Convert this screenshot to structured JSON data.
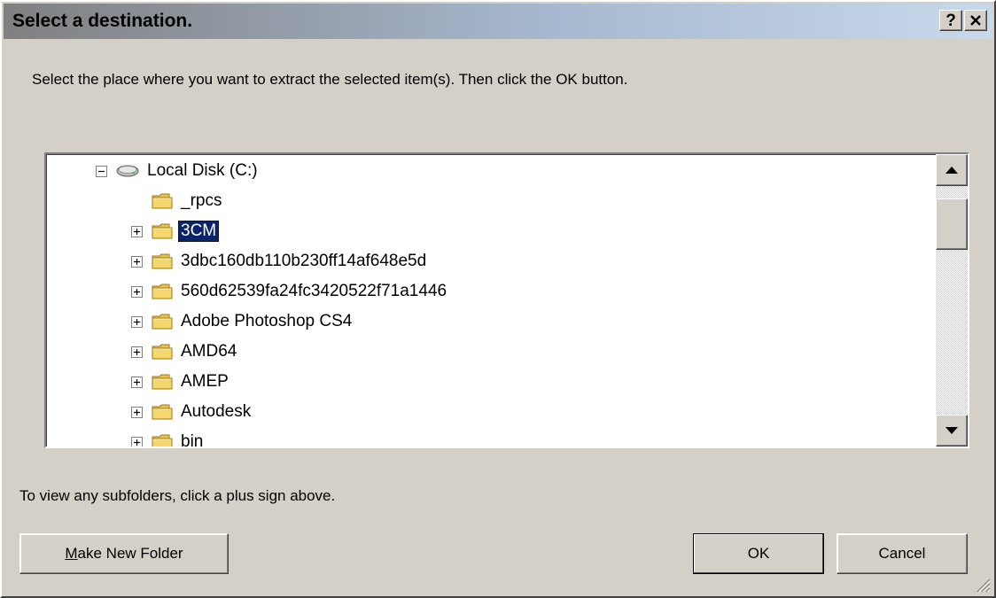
{
  "window": {
    "title": "Select a destination.",
    "help_label": "?"
  },
  "instructions": "Select the place where you want to extract the selected item(s).  Then click the OK button.",
  "tree": {
    "root": {
      "label": "Local Disk (C:)",
      "expanded": true,
      "icon": "hard-disk-icon"
    },
    "items": [
      {
        "label": "_rpcs",
        "has_children": false,
        "icon": "folder-icon"
      },
      {
        "label": "3CM",
        "has_children": true,
        "selected": true,
        "icon": "folder-icon"
      },
      {
        "label": "3dbc160db110b230ff14af648e5d",
        "has_children": true,
        "icon": "folder-icon"
      },
      {
        "label": "560d62539fa24fc3420522f71a1446",
        "has_children": true,
        "icon": "folder-icon"
      },
      {
        "label": "Adobe Photoshop CS4",
        "has_children": true,
        "icon": "folder-icon"
      },
      {
        "label": "AMD64",
        "has_children": true,
        "icon": "folder-icon"
      },
      {
        "label": "AMEP",
        "has_children": true,
        "icon": "folder-icon"
      },
      {
        "label": "Autodesk",
        "has_children": true,
        "icon": "folder-icon"
      },
      {
        "label": "bin",
        "has_children": true,
        "icon": "folder-icon"
      }
    ]
  },
  "hint": "To view any subfolders, click a plus sign above.",
  "buttons": {
    "make_new_folder_prefix": "M",
    "make_new_folder_rest": "ake New Folder",
    "ok": "OK",
    "cancel": "Cancel"
  },
  "colors": {
    "dialog_face": "#d4d0c8",
    "selection": "#0a246a",
    "folder": "#f5d76e"
  }
}
